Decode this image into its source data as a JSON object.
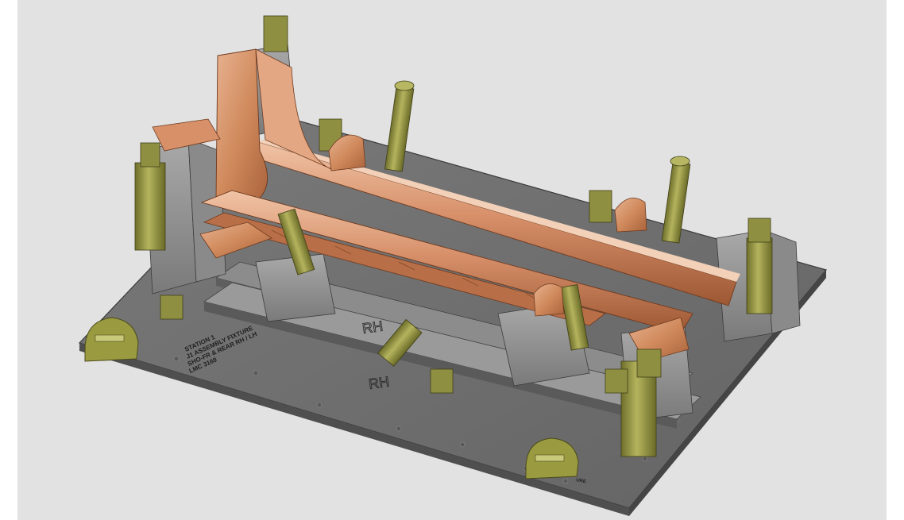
{
  "viewer": {
    "background_color": "#e2e2e2",
    "base_plate_color": "#6e6e6e",
    "part_color": "#d08a5c",
    "clamp_color": "#9a9a4a"
  },
  "engravings": {
    "plate_label_lines": [
      "STATION 1",
      "J1 ASSEMBLY FIXTURE",
      "SHO-FR & REAR RH / LH",
      "LMC 3169"
    ],
    "fixture_side_label": "RH",
    "base_side_label": "RH",
    "handle_label_partial": "URE"
  },
  "icons": {
    "lifting_handle_left": "lifting-handle-icon",
    "lifting_handle_right": "lifting-handle-icon"
  }
}
